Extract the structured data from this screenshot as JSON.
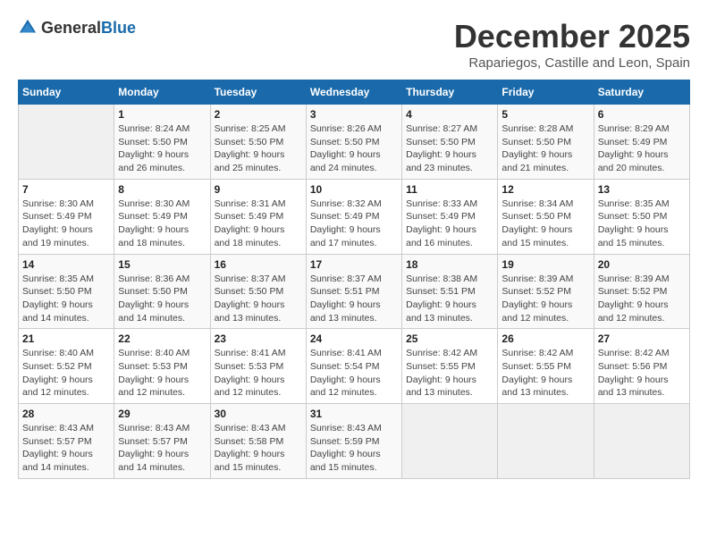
{
  "header": {
    "logo_general": "General",
    "logo_blue": "Blue",
    "month_year": "December 2025",
    "location": "Rapariegos, Castille and Leon, Spain"
  },
  "days_of_week": [
    "Sunday",
    "Monday",
    "Tuesday",
    "Wednesday",
    "Thursday",
    "Friday",
    "Saturday"
  ],
  "weeks": [
    [
      {
        "day": "",
        "info": ""
      },
      {
        "day": "1",
        "info": "Sunrise: 8:24 AM\nSunset: 5:50 PM\nDaylight: 9 hours\nand 26 minutes."
      },
      {
        "day": "2",
        "info": "Sunrise: 8:25 AM\nSunset: 5:50 PM\nDaylight: 9 hours\nand 25 minutes."
      },
      {
        "day": "3",
        "info": "Sunrise: 8:26 AM\nSunset: 5:50 PM\nDaylight: 9 hours\nand 24 minutes."
      },
      {
        "day": "4",
        "info": "Sunrise: 8:27 AM\nSunset: 5:50 PM\nDaylight: 9 hours\nand 23 minutes."
      },
      {
        "day": "5",
        "info": "Sunrise: 8:28 AM\nSunset: 5:50 PM\nDaylight: 9 hours\nand 21 minutes."
      },
      {
        "day": "6",
        "info": "Sunrise: 8:29 AM\nSunset: 5:49 PM\nDaylight: 9 hours\nand 20 minutes."
      }
    ],
    [
      {
        "day": "7",
        "info": "Sunrise: 8:30 AM\nSunset: 5:49 PM\nDaylight: 9 hours\nand 19 minutes."
      },
      {
        "day": "8",
        "info": "Sunrise: 8:30 AM\nSunset: 5:49 PM\nDaylight: 9 hours\nand 18 minutes."
      },
      {
        "day": "9",
        "info": "Sunrise: 8:31 AM\nSunset: 5:49 PM\nDaylight: 9 hours\nand 18 minutes."
      },
      {
        "day": "10",
        "info": "Sunrise: 8:32 AM\nSunset: 5:49 PM\nDaylight: 9 hours\nand 17 minutes."
      },
      {
        "day": "11",
        "info": "Sunrise: 8:33 AM\nSunset: 5:49 PM\nDaylight: 9 hours\nand 16 minutes."
      },
      {
        "day": "12",
        "info": "Sunrise: 8:34 AM\nSunset: 5:50 PM\nDaylight: 9 hours\nand 15 minutes."
      },
      {
        "day": "13",
        "info": "Sunrise: 8:35 AM\nSunset: 5:50 PM\nDaylight: 9 hours\nand 15 minutes."
      }
    ],
    [
      {
        "day": "14",
        "info": "Sunrise: 8:35 AM\nSunset: 5:50 PM\nDaylight: 9 hours\nand 14 minutes."
      },
      {
        "day": "15",
        "info": "Sunrise: 8:36 AM\nSunset: 5:50 PM\nDaylight: 9 hours\nand 14 minutes."
      },
      {
        "day": "16",
        "info": "Sunrise: 8:37 AM\nSunset: 5:50 PM\nDaylight: 9 hours\nand 13 minutes."
      },
      {
        "day": "17",
        "info": "Sunrise: 8:37 AM\nSunset: 5:51 PM\nDaylight: 9 hours\nand 13 minutes."
      },
      {
        "day": "18",
        "info": "Sunrise: 8:38 AM\nSunset: 5:51 PM\nDaylight: 9 hours\nand 13 minutes."
      },
      {
        "day": "19",
        "info": "Sunrise: 8:39 AM\nSunset: 5:52 PM\nDaylight: 9 hours\nand 12 minutes."
      },
      {
        "day": "20",
        "info": "Sunrise: 8:39 AM\nSunset: 5:52 PM\nDaylight: 9 hours\nand 12 minutes."
      }
    ],
    [
      {
        "day": "21",
        "info": "Sunrise: 8:40 AM\nSunset: 5:52 PM\nDaylight: 9 hours\nand 12 minutes."
      },
      {
        "day": "22",
        "info": "Sunrise: 8:40 AM\nSunset: 5:53 PM\nDaylight: 9 hours\nand 12 minutes."
      },
      {
        "day": "23",
        "info": "Sunrise: 8:41 AM\nSunset: 5:53 PM\nDaylight: 9 hours\nand 12 minutes."
      },
      {
        "day": "24",
        "info": "Sunrise: 8:41 AM\nSunset: 5:54 PM\nDaylight: 9 hours\nand 12 minutes."
      },
      {
        "day": "25",
        "info": "Sunrise: 8:42 AM\nSunset: 5:55 PM\nDaylight: 9 hours\nand 13 minutes."
      },
      {
        "day": "26",
        "info": "Sunrise: 8:42 AM\nSunset: 5:55 PM\nDaylight: 9 hours\nand 13 minutes."
      },
      {
        "day": "27",
        "info": "Sunrise: 8:42 AM\nSunset: 5:56 PM\nDaylight: 9 hours\nand 13 minutes."
      }
    ],
    [
      {
        "day": "28",
        "info": "Sunrise: 8:43 AM\nSunset: 5:57 PM\nDaylight: 9 hours\nand 14 minutes."
      },
      {
        "day": "29",
        "info": "Sunrise: 8:43 AM\nSunset: 5:57 PM\nDaylight: 9 hours\nand 14 minutes."
      },
      {
        "day": "30",
        "info": "Sunrise: 8:43 AM\nSunset: 5:58 PM\nDaylight: 9 hours\nand 15 minutes."
      },
      {
        "day": "31",
        "info": "Sunrise: 8:43 AM\nSunset: 5:59 PM\nDaylight: 9 hours\nand 15 minutes."
      },
      {
        "day": "",
        "info": ""
      },
      {
        "day": "",
        "info": ""
      },
      {
        "day": "",
        "info": ""
      }
    ]
  ]
}
